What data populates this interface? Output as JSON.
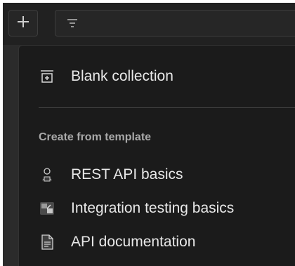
{
  "toolbar": {
    "new_button_icon": "plus-icon",
    "filter_icon": "filter-icon"
  },
  "menu": {
    "blank_collection": {
      "label": "Blank collection",
      "icon": "blank-collection-icon"
    },
    "template_heading": "Create from template",
    "templates": [
      {
        "label": "REST API basics",
        "icon": "rest-api-icon"
      },
      {
        "label": "Integration testing basics",
        "icon": "integration-testing-icon"
      },
      {
        "label": "API documentation",
        "icon": "api-documentation-icon"
      }
    ]
  },
  "colors": {
    "background": "#1b1b1b",
    "text": "#e8e8e8",
    "heading": "#a9a9a9",
    "accent": "#ff6c37"
  }
}
